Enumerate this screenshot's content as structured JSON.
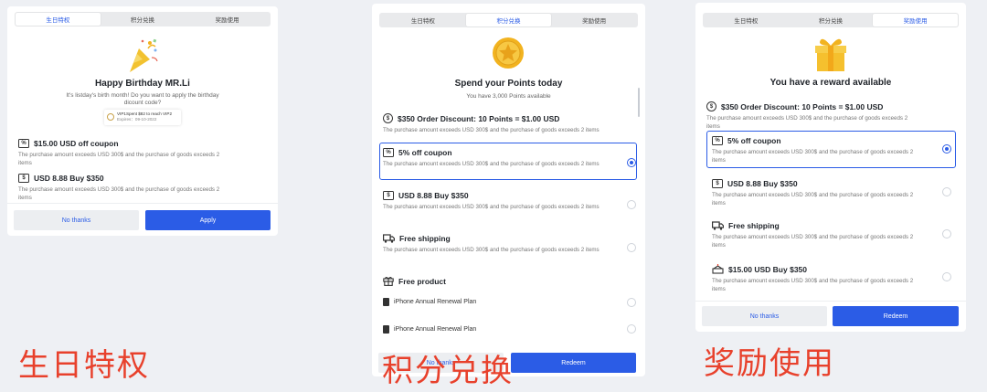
{
  "tabs": [
    "生日特权",
    "积分兑换",
    "奖励使用"
  ],
  "birthday": {
    "title": "Happy Birthday MR.Li",
    "subtitle_line1": "It's listday's birth month! Do you want to apply the birthday",
    "subtitle_line2": "dicount code?",
    "vip_line1": "VIP1Spent $82 to reach VIP2",
    "vip_line2": "Expires：09-10-2022",
    "items": [
      {
        "icon": "percent-coupon-icon",
        "name": "$15.00 USD off coupon",
        "desc": "The purchase amount exceeds USD 300$ and the purchase of goods exceeds 2 items"
      },
      {
        "icon": "dollar-coupon-icon",
        "name": "USD 8.88  Buy $350",
        "desc": "The purchase amount exceeds USD 300$ and the purchase of goods exceeds 2 items"
      }
    ],
    "no_thanks": "No thanks",
    "apply": "Apply"
  },
  "points": {
    "title": "Spend your Points today",
    "subtitle": "You have 3,000 Points available",
    "discount": "$350 Order Discount: 10 Points = $1.00 USD",
    "discount_desc": "The purchase amount exceeds USD 300$ and the purchase of goods exceeds 2 items",
    "items": [
      {
        "icon": "percent-coupon-icon",
        "name": "5% off coupon",
        "desc": "The purchase amount exceeds USD 300$ and the purchase of goods exceeds 2 items",
        "selected": true
      },
      {
        "icon": "dollar-coupon-icon",
        "name": "USD 8.88  Buy $350",
        "desc": "The purchase amount exceeds USD 300$ and the purchase of goods exceeds 2 items",
        "selected": false
      },
      {
        "icon": "truck-icon",
        "name": "Free shipping",
        "desc": "The purchase amount exceeds USD 300$ and the purchase of goods exceeds 2 items",
        "selected": false
      }
    ],
    "free_product": "Free product",
    "products": [
      "iPhone Annual Renewal Plan",
      "iPhone Annual Renewal Plan"
    ],
    "no_thanks": "No thanks",
    "redeem": "Redeem"
  },
  "reward": {
    "title": "You have a reward available",
    "discount": "$350 Order Discount: 10 Points = $1.00 USD",
    "discount_desc": "The purchase amount exceeds USD 300$ and the purchase of goods exceeds 2 items",
    "items": [
      {
        "icon": "percent-coupon-icon",
        "name": "5% off coupon",
        "desc": "The purchase amount exceeds USD 300$ and the purchase of goods exceeds 2 items",
        "selected": true
      },
      {
        "icon": "dollar-coupon-icon",
        "name": "USD 8.88  Buy $350",
        "desc": "The purchase amount exceeds USD 300$ and the purchase of goods exceeds 2 items",
        "selected": false
      },
      {
        "icon": "truck-icon",
        "name": "Free shipping",
        "desc": "The purchase amount exceeds USD 300$ and the purchase of goods exceeds 2 items",
        "selected": false
      },
      {
        "icon": "cake-icon",
        "name": "$15.00 USD Buy $350",
        "desc": "The purchase amount exceeds USD 300$ and the purchase of goods exceeds 2 items",
        "selected": false
      }
    ],
    "no_thanks": "No thanks",
    "redeem": "Redeem"
  },
  "captions": [
    "生日特权",
    "积分兑换",
    "奖励使用"
  ],
  "colors": {
    "accent": "#2b5ce6",
    "caption": "#e8412c",
    "gold": "#f2b31f"
  }
}
